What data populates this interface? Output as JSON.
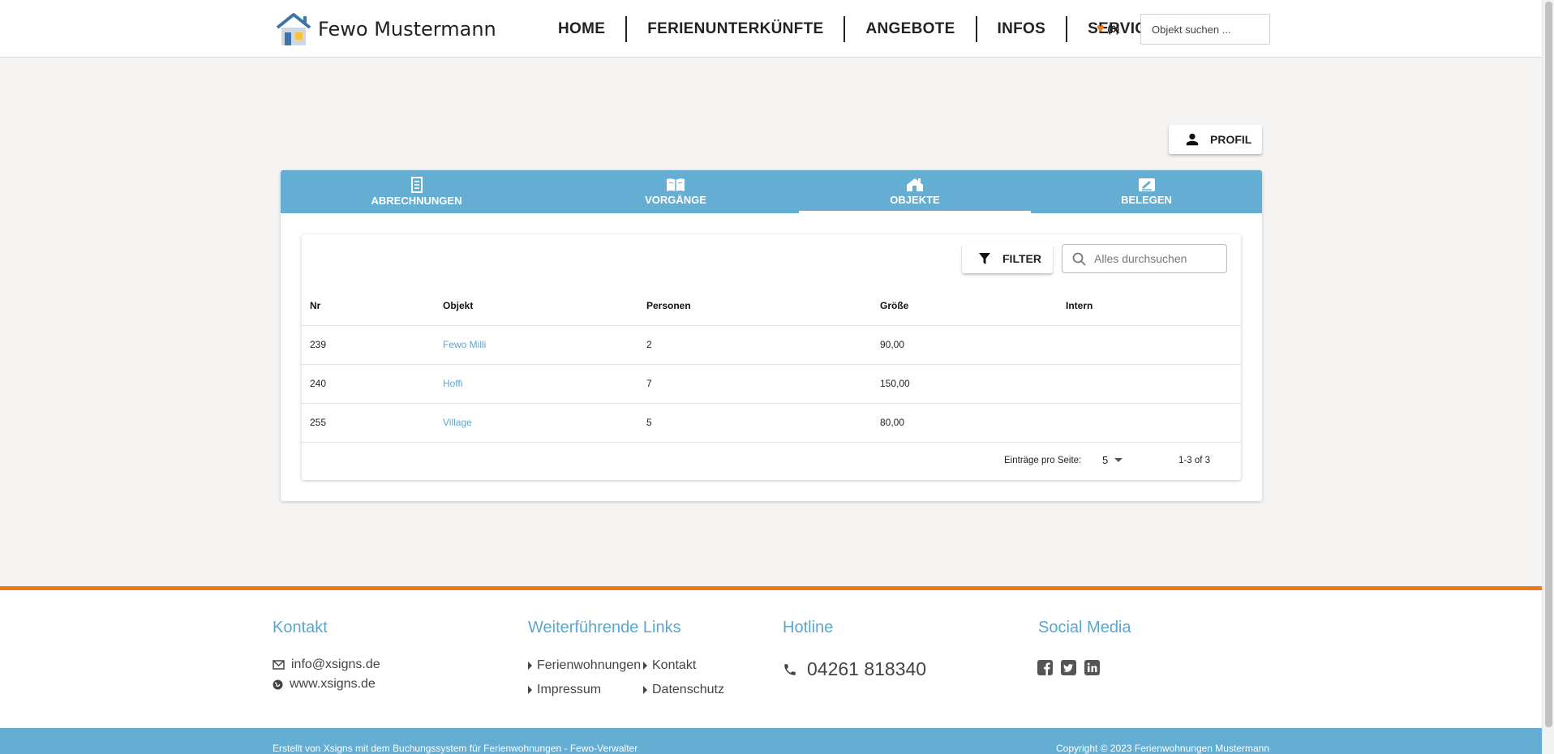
{
  "header": {
    "logo_text": "Fewo Mustermann",
    "nav": [
      "HOME",
      "FERIENUNTERKÜNFTE",
      "ANGEBOTE",
      "INFOS",
      "SERVICE"
    ],
    "favorites_count": "(0)",
    "search_placeholder": "Objekt suchen ..."
  },
  "profile": {
    "label": "PROFIL"
  },
  "tabs": [
    {
      "label": "ABRECHNUNGEN",
      "icon": "receipt-icon"
    },
    {
      "label": "VORGÄNGE",
      "icon": "book-icon"
    },
    {
      "label": "OBJEKTE",
      "icon": "house-icon",
      "active": true
    },
    {
      "label": "BELEGEN",
      "icon": "edit-icon"
    }
  ],
  "toolbar": {
    "filter_label": "FILTER",
    "search_placeholder": "Alles durchsuchen"
  },
  "table": {
    "headers": [
      "Nr",
      "Objekt",
      "Personen",
      "Größe",
      "Intern"
    ],
    "rows": [
      [
        "239",
        "Fewo Milli",
        "2",
        "90,00",
        ""
      ],
      [
        "240",
        "Hoffi",
        "7",
        "150,00",
        ""
      ],
      [
        "255",
        "Village",
        "5",
        "80,00",
        ""
      ]
    ]
  },
  "pager": {
    "label": "Einträge pro Seite:",
    "per_page": "5",
    "range": "1-3 of 3"
  },
  "footer": {
    "kontakt": {
      "title": "Kontakt",
      "email": "info@xsigns.de",
      "web": "www.xsigns.de"
    },
    "links": {
      "title": "Weiterführende Links",
      "items": [
        "Ferienwohnungen",
        "Kontakt",
        "Impressum",
        "Datenschutz"
      ]
    },
    "hotline": {
      "title": "Hotline",
      "phone": "04261 818340"
    },
    "social": {
      "title": "Social Media",
      "icons": [
        "facebook-icon",
        "twitter-icon",
        "linkedin-icon"
      ]
    },
    "bottom_left": "Erstellt von Xsigns mit dem Buchungssystem für Ferienwohnungen - Fewo-Verwalter",
    "bottom_right": "Copyright © 2023 Ferienwohnungen Mustermann"
  },
  "colors": {
    "accent": "#64aed3",
    "orange": "#f07a1a",
    "link": "#5aa6cf"
  }
}
